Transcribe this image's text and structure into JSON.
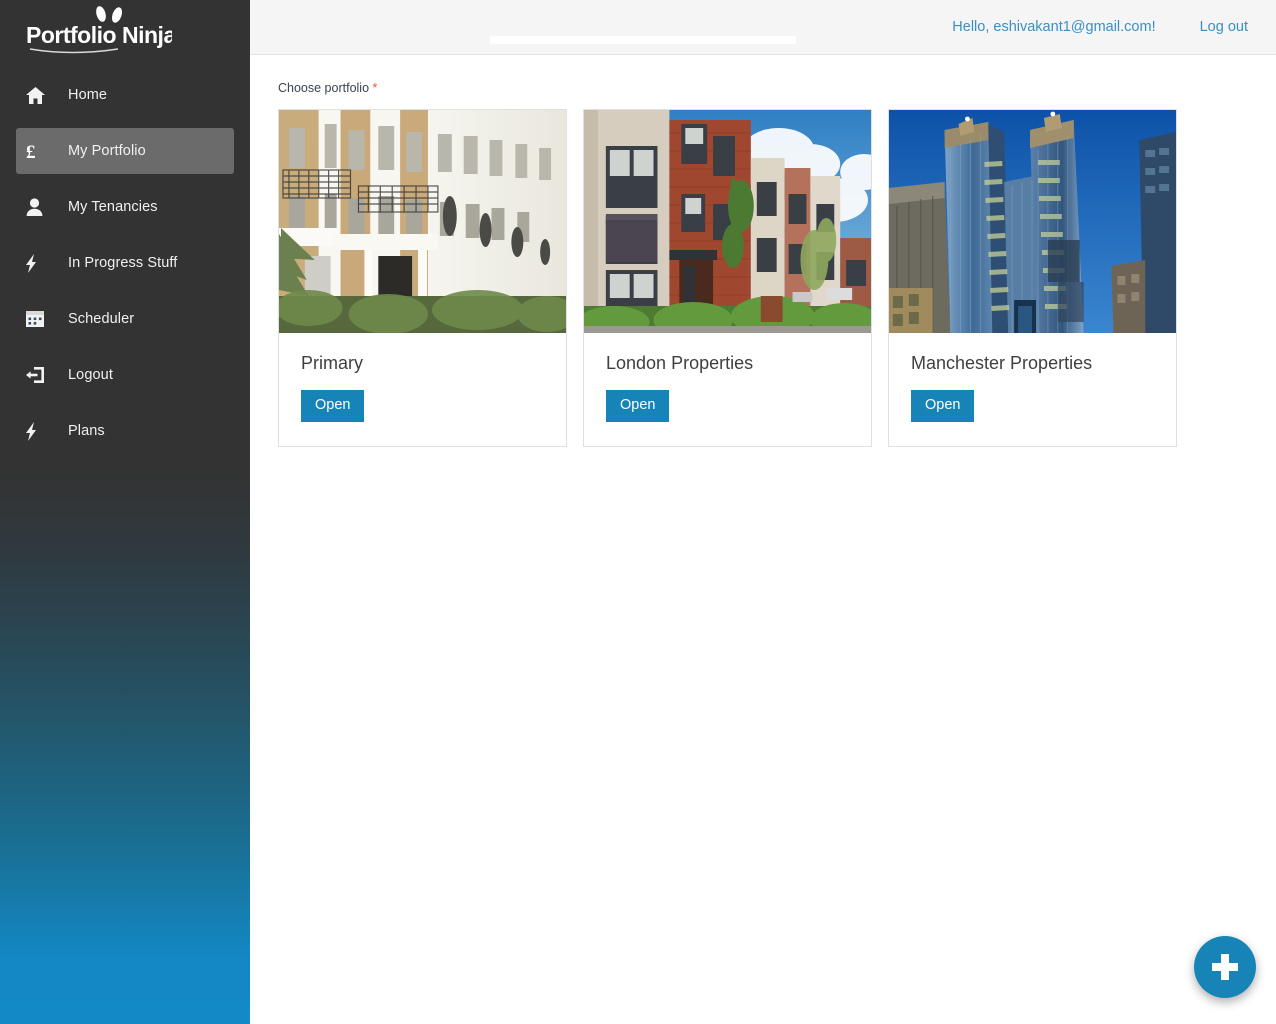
{
  "brand": {
    "name_part1": "Portfolio",
    "name_part2": "Ninja",
    "logo_alt": "portfolio-ninja-logo"
  },
  "sidebar": {
    "items": [
      {
        "label": "Home",
        "icon": "home-icon",
        "active": false
      },
      {
        "label": "My Portfolio",
        "icon": "pound-icon",
        "active": true
      },
      {
        "label": "My Tenancies",
        "icon": "user-icon",
        "active": false
      },
      {
        "label": "In Progress Stuff",
        "icon": "bolt-icon",
        "active": false
      },
      {
        "label": "Scheduler",
        "icon": "calendar-icon",
        "active": false
      },
      {
        "label": "Logout",
        "icon": "sign-out-icon",
        "active": false
      },
      {
        "label": "Plans",
        "icon": "bolt-icon",
        "active": false
      }
    ]
  },
  "topbar": {
    "greeting": "Hello, eshivakant1@gmail.com!",
    "logout_label": "Log out"
  },
  "main": {
    "field_label": "Choose portfolio",
    "required_marker": "*",
    "cards": [
      {
        "title": "Primary",
        "button_label": "Open",
        "image": "white-georgian-terrace-photo"
      },
      {
        "title": "London Properties",
        "button_label": "Open",
        "image": "modern-brick-townhouses-photo"
      },
      {
        "title": "Manchester Properties",
        "button_label": "Open",
        "image": "glass-skyscrapers-photo"
      }
    ]
  },
  "fab": {
    "label": "+",
    "name": "add-portfolio-button"
  },
  "colors": {
    "accent_blue": "#1784b8",
    "link_blue": "#3a90c6",
    "sidebar_top": "#333333",
    "sidebar_bottom": "#1389c5",
    "active_item": "#6b6b6b",
    "required_star": "#e8572a",
    "topbar_bg": "#f5f5f5",
    "card_border": "#e0e0e0"
  }
}
